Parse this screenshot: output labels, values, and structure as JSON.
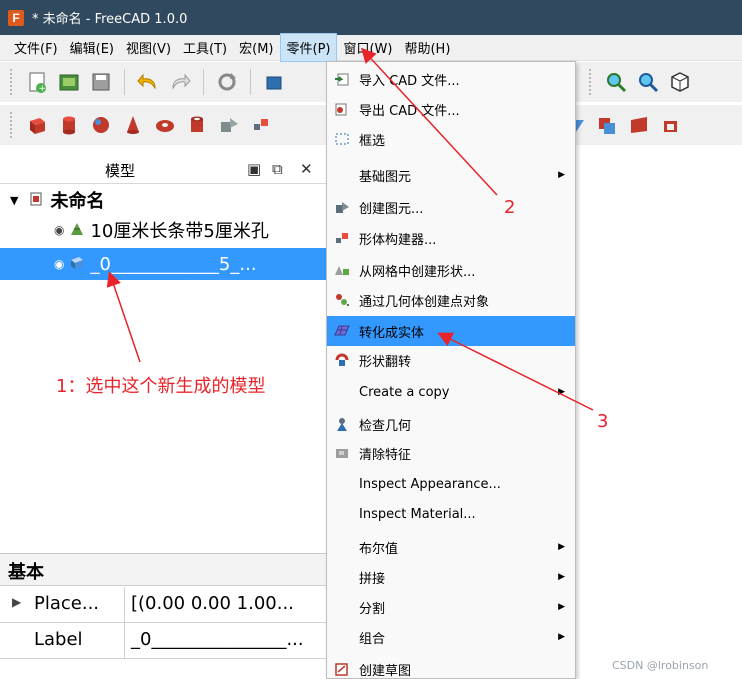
{
  "window": {
    "title": "* 未命名 - FreeCAD 1.0.0",
    "logo_letter": "F"
  },
  "menubar": [
    {
      "label": "文件(F)",
      "active": false
    },
    {
      "label": "编辑(E)",
      "active": false
    },
    {
      "label": "视图(V)",
      "active": false
    },
    {
      "label": "工具(T)",
      "active": false
    },
    {
      "label": "宏(M)",
      "active": false
    },
    {
      "label": "零件(P)",
      "active": true
    },
    {
      "label": "窗口(W)",
      "active": false
    },
    {
      "label": "帮助(H)",
      "active": false
    }
  ],
  "model_panel": {
    "title": "模型",
    "doc_name": "未命名",
    "items": [
      {
        "label": "10厘米长条带5厘米孔",
        "selected": false
      },
      {
        "label": "_0____________5_...",
        "selected": true
      }
    ]
  },
  "property_panel": {
    "group": "基本",
    "rows": [
      {
        "key": "Place...",
        "value": "[(0.00 0.00 1.00...",
        "expandable": true
      },
      {
        "key": "Label",
        "value": "_0_______________...",
        "expandable": false
      }
    ]
  },
  "dropdown": {
    "items": [
      {
        "label": "导入 CAD 文件...",
        "icon": "import-icon"
      },
      {
        "label": "导出 CAD 文件...",
        "icon": "export-icon"
      },
      {
        "label": "框选",
        "icon": "box-select-icon"
      },
      {
        "label": "基础图元",
        "submenu": true
      },
      {
        "label": "创建图元...",
        "icon": "primitives-icon"
      },
      {
        "label": "形体构建器...",
        "icon": "shape-builder-icon"
      },
      {
        "label": "从网格中创建形状...",
        "icon": "mesh-to-shape-icon"
      },
      {
        "label": "通过几何体创建点对象",
        "icon": "points-icon"
      },
      {
        "label": "转化成实体",
        "icon": "convert-solid-icon",
        "highlight": true
      },
      {
        "label": "形状翻转",
        "icon": "reverse-shape-icon"
      },
      {
        "label": "Create a copy",
        "submenu": true
      },
      {
        "label": "检查几何",
        "icon": "check-geometry-icon"
      },
      {
        "label": "清除特征",
        "icon": "refine-shape-icon"
      },
      {
        "label": "Inspect Appearance..."
      },
      {
        "label": "Inspect Material..."
      },
      {
        "label": "布尔值",
        "submenu": true
      },
      {
        "label": "拼接",
        "submenu": true
      },
      {
        "label": "分割",
        "submenu": true
      },
      {
        "label": "组合",
        "submenu": true
      },
      {
        "label": "创建草图",
        "icon": "sketch-icon"
      }
    ]
  },
  "annotations": {
    "step1": "1：选中这个新生成的模型",
    "step2": "2",
    "step3": "3",
    "color": "#e8242a"
  },
  "watermark": "CSDN @lrobinson",
  "colors": {
    "titlebar": "#30495e",
    "selection": "#3399ff",
    "menu_active": "#cce4f7"
  }
}
